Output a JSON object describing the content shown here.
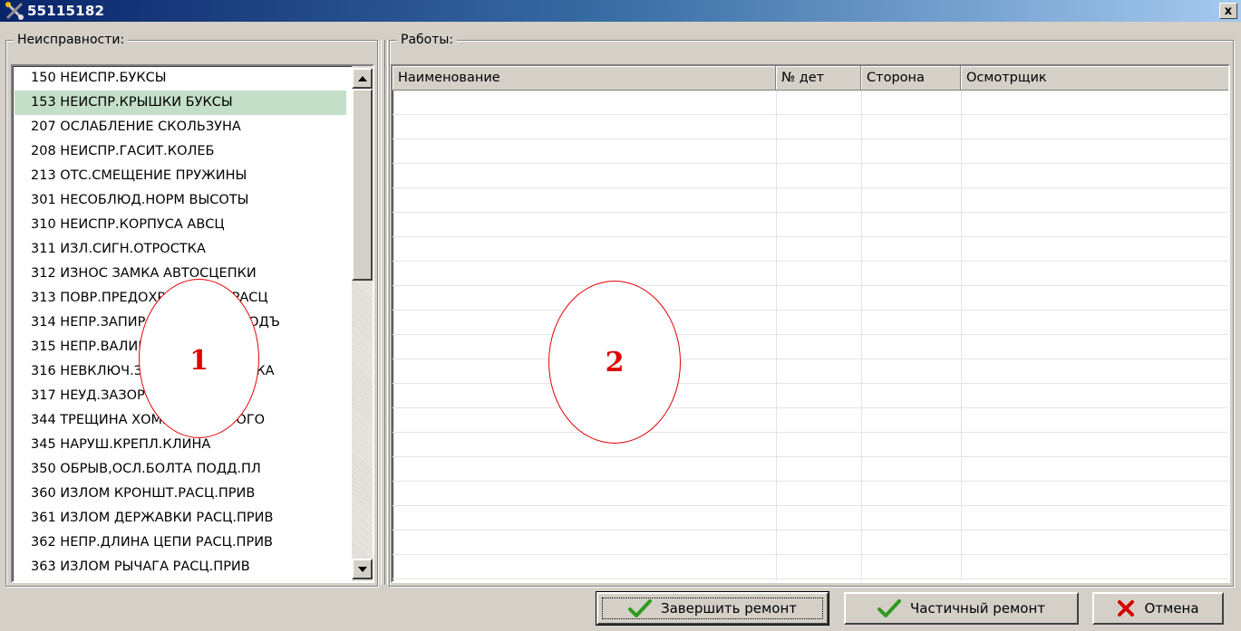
{
  "window": {
    "title": "55115182",
    "close_label": "x"
  },
  "faults": {
    "title": "Неисправности:",
    "items": [
      {
        "label": "150 НЕИСПР.БУКСЫ",
        "selected": false
      },
      {
        "label": "153 НЕИСПР.КРЫШКИ БУКСЫ",
        "selected": true
      },
      {
        "label": "207 ОСЛАБЛЕНИЕ СКОЛЬЗУНА",
        "selected": false
      },
      {
        "label": "208 НЕИСПР.ГАСИТ.КОЛЕБ",
        "selected": false
      },
      {
        "label": "213 ОТС.СМЕЩЕНИЕ ПРУЖИНЫ",
        "selected": false
      },
      {
        "label": "301 НЕСОБЛЮД.НОРМ ВЫСОТЫ",
        "selected": false
      },
      {
        "label": "310 НЕИСПР.КОРПУСА АВСЦ",
        "selected": false
      },
      {
        "label": "311 ИЗЛ.СИГН.ОТРОСТКА",
        "selected": false
      },
      {
        "label": "312 ИЗНОС ЗАМКА АВТОСЦЕПКИ",
        "selected": false
      },
      {
        "label": "313 ПОВР.ПРЕДОХР.ОТ САМОРАСЦ",
        "selected": false
      },
      {
        "label": "314 НЕПР.ЗАПИРАНИЯ ЗАМКА ПОДЪ",
        "selected": false
      },
      {
        "label": "315 НЕПР.ВАЛИКА АВСЦ",
        "selected": false
      },
      {
        "label": "316 НЕВКЛЮЧ.ЗАМКОДЕРЖ.ЗАМКА",
        "selected": false
      },
      {
        "label": "317 НЕУД.ЗАЗОР В ХВОСТ",
        "selected": false
      },
      {
        "label": "344 ТРЕЩИНА ХОМУТА ТЯГОВОГО",
        "selected": false
      },
      {
        "label": "345 НАРУШ.КРЕПЛ.КЛИНА",
        "selected": false
      },
      {
        "label": "350 ОБРЫВ,ОСЛ.БОЛТА ПОДД.ПЛ",
        "selected": false
      },
      {
        "label": "360 ИЗЛОМ КРОНШТ.РАСЦ.ПРИВ",
        "selected": false
      },
      {
        "label": "361 ИЗЛОМ ДЕРЖАВКИ РАСЦ.ПРИВ",
        "selected": false
      },
      {
        "label": "362 НЕПР.ДЛИНА ЦЕПИ РАСЦ.ПРИВ",
        "selected": false
      },
      {
        "label": "363 ИЗЛОМ РЫЧАГА РАСЦ.ПРИВ",
        "selected": false
      }
    ],
    "scroll_position": 0.0
  },
  "works": {
    "title": "Работы:",
    "columns": [
      "Наименование",
      "№ дет",
      "Сторона",
      "Осмотрщик"
    ],
    "rows": []
  },
  "callouts": [
    "1",
    "2"
  ],
  "buttons": {
    "finish": "Завершить ремонт",
    "partial": "Частичный ремонт",
    "cancel": "Отмена"
  },
  "colors": {
    "selected_row": "#c3dfc8",
    "callout": "#e00000",
    "check_icon": "#2e9b1e",
    "cancel_icon": "#d40000"
  }
}
